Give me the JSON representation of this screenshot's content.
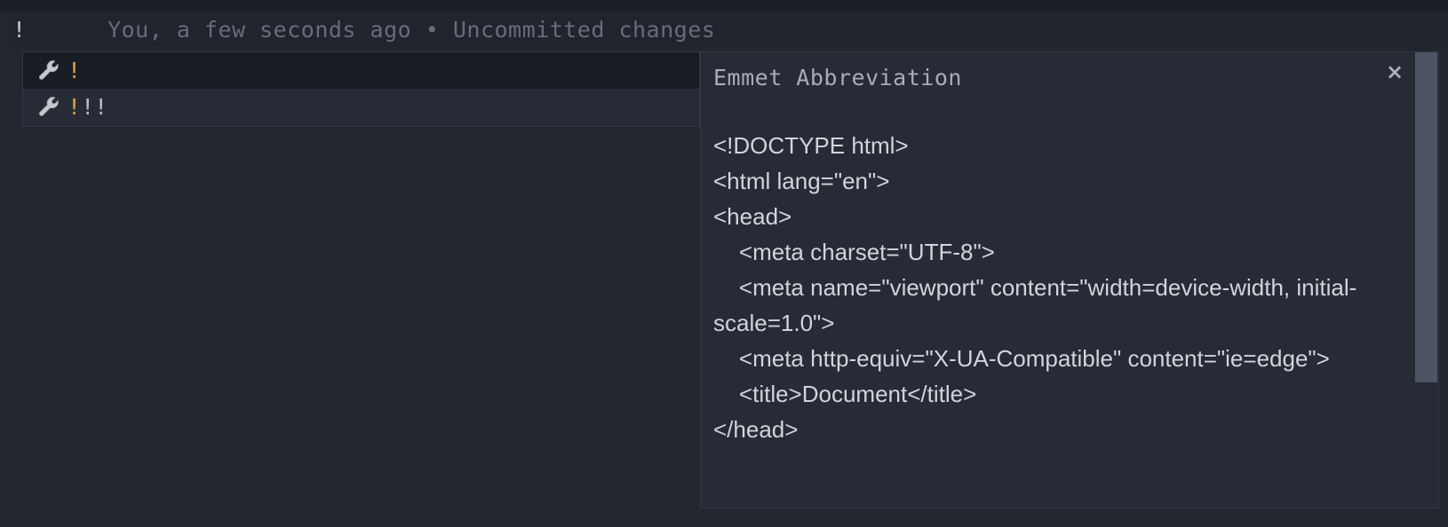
{
  "editor": {
    "line_text": "!",
    "blame_annotation": "You, a few seconds ago • Uncommitted changes"
  },
  "suggestions": {
    "items": [
      {
        "icon": "wrench-icon",
        "matched_prefix": "!",
        "remaining_text": "",
        "selected": true
      },
      {
        "icon": "wrench-icon",
        "matched_prefix": "!",
        "remaining_text": "!!",
        "selected": false
      }
    ]
  },
  "documentation": {
    "title": "Emmet Abbreviation",
    "close_label": "×",
    "code": "<!DOCTYPE html>\n<html lang=\"en\">\n<head>\n    <meta charset=\"UTF-8\">\n    <meta name=\"viewport\" content=\"width=device-width, initial-scale=1.0\">\n    <meta http-equiv=\"X-UA-Compatible\" content=\"ie=edge\">\n    <title>Document</title>\n</head>"
  },
  "colors": {
    "editor_background": "#22262e",
    "widget_background": "#272b35",
    "selected_row_background": "#181c25",
    "widget_border": "#333845",
    "match_highlight": "#e8a33d",
    "scrollbar_thumb": "#4c5566",
    "blame_text": "#666c7c"
  }
}
